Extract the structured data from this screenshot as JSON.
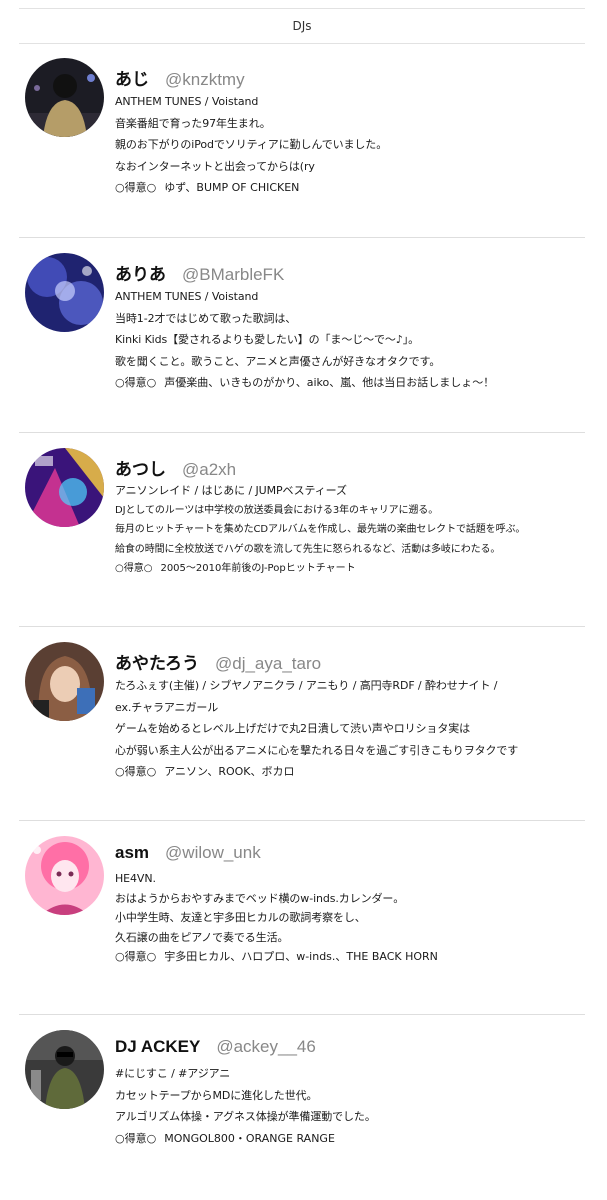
{
  "header": {
    "title": "DJs"
  },
  "djs": [
    {
      "name": "あじ",
      "handle": "@knzktmy",
      "lines": [
        "ANTHEM TUNES / Voistand",
        "音楽番組で育った97年生まれ。",
        "親のお下がりのiPodでソリティアに勤しんでいました。",
        "なおインターネットと出会ってからは(ry"
      ],
      "specialty_label": "○得意○",
      "specialty": "ゆず、BUMP OF CHICKEN",
      "avatar_icon": "avatar-dj-aji",
      "avatar_colors": [
        "#1b1b22",
        "#c8b27a"
      ]
    },
    {
      "name": "ありあ",
      "handle": "@BMarbleFK",
      "lines": [
        "ANTHEM TUNES / Voistand",
        "当時1-2才ではじめて歌った歌詞は、",
        "Kinki Kids【愛されるよりも愛したい】の「ま〜じ〜で〜♪」。",
        "歌を聞くこと。歌うこと、アニメと声優さんが好きなオタクです。"
      ],
      "specialty_label": "○得意○",
      "specialty": "声優楽曲、いきものがかり、aiko、嵐、他は当日お話しましょ〜！",
      "avatar_icon": "avatar-dj-aria",
      "avatar_colors": [
        "#2a2f7a",
        "#8fa0ff"
      ]
    },
    {
      "name": "あつし",
      "handle": "@a2xh",
      "lines": [
        "アニソンレイド / はじあに / JUMPベスティーズ",
        "DJとしてのルーツは中学校の放送委員会における3年のキャリアに遡る。",
        "毎月のヒットチャートを集めたCDアルバムを作成し、最先端の楽曲セレクトで話題を呼ぶ。",
        "給食の時間に全校放送でハゲの歌を流して先生に怒られるなど、活動は多岐にわたる。"
      ],
      "specialty_label": "○得意○",
      "specialty": "2005〜2010年前後のJ-Popヒットチャート",
      "avatar_icon": "avatar-dj-atsushi",
      "avatar_colors": [
        "#5a1fa8",
        "#ff3d9a"
      ]
    },
    {
      "name": "あやたろう",
      "handle": "@dj_aya_taro",
      "lines": [
        "たろふぇす(主催) / シブヤノアニクラ / アニもり / 高円寺RDF / 酔わせナイト /",
        "ex.チャラアニガール",
        "ゲームを始めるとレベル上げだけで丸2日潰して渋い声やロリショタ実は",
        "心が弱い系主人公が出るアニメに心を撃たれる日々を過ごす引きこもりヲタクです"
      ],
      "specialty_label": "○得意○",
      "specialty": "アニソン、ROOK、ボカロ",
      "avatar_icon": "avatar-dj-ayataro",
      "avatar_colors": [
        "#6b4a3a",
        "#e8c9b0"
      ]
    },
    {
      "name": "asm",
      "handle": "@wilow_unk",
      "lines": [
        "HE4VN.",
        "おはようからおやすみまでベッド横のw-inds.カレンダー。",
        "小中学生時、友達と宇多田ヒカルの歌詞考察をし、",
        "久石譲の曲をピアノで奏でる生活。"
      ],
      "specialty_label": "○得意○",
      "specialty": "宇多田ヒカル、ハロプロ、w-inds.、THE BACK HORN",
      "avatar_icon": "avatar-dj-asm",
      "avatar_colors": [
        "#ff7fb0",
        "#ffd1e3"
      ]
    },
    {
      "name": "DJ ACKEY",
      "handle": "@ackey__46",
      "lines": [
        "#にじすこ / #アジアニ",
        "カセットテープからMDに進化した世代。",
        "アルゴリズム体操・アグネス体操が準備運動でした。"
      ],
      "specialty_label": "○得意○",
      "specialty": "MONGOL800・ORANGE RANGE",
      "avatar_icon": "avatar-dj-ackey",
      "avatar_colors": [
        "#2c2c2c",
        "#9a9a9a"
      ]
    }
  ]
}
